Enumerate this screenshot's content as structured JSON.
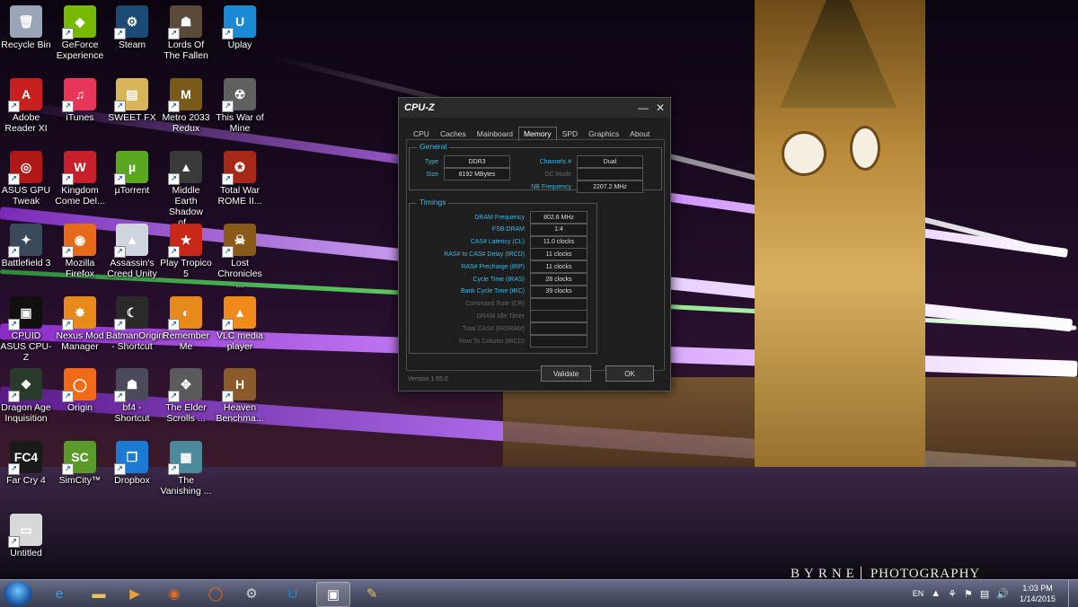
{
  "desktop": {
    "icons": [
      {
        "label": "Recycle Bin",
        "glyph": "🗑",
        "color": "#9aa6b8"
      },
      {
        "label": "GeForce Experience",
        "glyph": "◆",
        "color": "#76b900"
      },
      {
        "label": "Steam",
        "glyph": "⚙",
        "color": "#1b4b74"
      },
      {
        "label": "Lords Of The Fallen",
        "glyph": "☗",
        "color": "#5a4a3a"
      },
      {
        "label": "Uplay",
        "glyph": "U",
        "color": "#1a8ad4"
      },
      {
        "label": "Adobe Reader XI",
        "glyph": "A",
        "color": "#c8201e"
      },
      {
        "label": "iTunes",
        "glyph": "♫",
        "color": "#e8365a"
      },
      {
        "label": "SWEET FX",
        "glyph": "▤",
        "color": "#d8b45a"
      },
      {
        "label": "Metro 2033 Redux",
        "glyph": "M",
        "color": "#7a5a1a"
      },
      {
        "label": "This War of Mine",
        "glyph": "☢",
        "color": "#606060"
      },
      {
        "label": "ASUS GPU Tweak",
        "glyph": "◎",
        "color": "#b01818"
      },
      {
        "label": "Kingdom Come Del...",
        "glyph": "W",
        "color": "#c8202a"
      },
      {
        "label": "µTorrent",
        "glyph": "µ",
        "color": "#5aa820"
      },
      {
        "label": "Middle Earth Shadow of...",
        "glyph": "▲",
        "color": "#3a3a3a"
      },
      {
        "label": "Total War ROME II...",
        "glyph": "✪",
        "color": "#a82818"
      },
      {
        "label": "Battlefield 3",
        "glyph": "✦",
        "color": "#3a4a5a"
      },
      {
        "label": "Mozilla Firefox",
        "glyph": "◉",
        "color": "#e66a1a"
      },
      {
        "label": "Assassin's Creed Unity",
        "glyph": "▲",
        "color": "#cfd6de"
      },
      {
        "label": "Play Tropico 5",
        "glyph": "★",
        "color": "#c82818"
      },
      {
        "label": "Lost Chronicles ...",
        "glyph": "☠",
        "color": "#8a5a1a"
      },
      {
        "label": "CPUID ASUS CPU-Z",
        "glyph": "▣",
        "color": "#101010"
      },
      {
        "label": "Nexus Mod Manager",
        "glyph": "✸",
        "color": "#e88a1a"
      },
      {
        "label": "BatmanOrigins - Shortcut",
        "glyph": "☾",
        "color": "#2a2a2a"
      },
      {
        "label": "Remember Me",
        "glyph": "◐",
        "color": "#e88a1a"
      },
      {
        "label": "VLC media player",
        "glyph": "▲",
        "color": "#f08a1a"
      },
      {
        "label": "Dragon Age Inquisition",
        "glyph": "❖",
        "color": "#2a3a2a"
      },
      {
        "label": "Origin",
        "glyph": "◯",
        "color": "#f06a1a"
      },
      {
        "label": "bf4 - Shortcut",
        "glyph": "☗",
        "color": "#4a4a5a"
      },
      {
        "label": "The Elder Scrolls ...",
        "glyph": "✥",
        "color": "#5a5a5a"
      },
      {
        "label": "Heaven Benchma...",
        "glyph": "H",
        "color": "#8a5a2a"
      },
      {
        "label": "Far Cry 4",
        "glyph": "FC4",
        "color": "#1a1a1a"
      },
      {
        "label": "SimCity™",
        "glyph": "SC",
        "color": "#5a9a2a"
      },
      {
        "label": "Dropbox",
        "glyph": "❒",
        "color": "#1a7ad4"
      },
      {
        "label": "The Vanishing ...",
        "glyph": "▦",
        "color": "#4a8a9a"
      },
      {
        "label": "",
        "glyph": "",
        "color": "transparent"
      },
      {
        "label": "Untitled",
        "glyph": "▭",
        "color": "#d8d8d8"
      }
    ]
  },
  "cpuz": {
    "title": "CPU-Z",
    "tabs": [
      "CPU",
      "Caches",
      "Mainboard",
      "Memory",
      "SPD",
      "Graphics",
      "About"
    ],
    "active_tab": "Memory",
    "general": {
      "title": "General",
      "type_label": "Type",
      "type_value": "DDR3",
      "size_label": "Size",
      "size_value": "8192 MBytes",
      "channels_label": "Channels #",
      "channels_value": "Dual",
      "dc_mode_label": "DC Mode",
      "dc_mode_value": "",
      "nb_freq_label": "NB Frequency",
      "nb_freq_value": "2207.2 MHz"
    },
    "timings": {
      "title": "Timings",
      "rows": [
        {
          "label": "DRAM Frequency",
          "value": "802.6 MHz",
          "enabled": true
        },
        {
          "label": "FSB:DRAM",
          "value": "1:4",
          "enabled": true
        },
        {
          "label": "CAS# Latency (CL)",
          "value": "11.0 clocks",
          "enabled": true
        },
        {
          "label": "RAS# to CAS# Delay (tRCD)",
          "value": "11 clocks",
          "enabled": true
        },
        {
          "label": "RAS# Precharge (tRP)",
          "value": "11 clocks",
          "enabled": true
        },
        {
          "label": "Cycle Time (tRAS)",
          "value": "28 clocks",
          "enabled": true
        },
        {
          "label": "Bank Cycle Time (tRC)",
          "value": "39 clocks",
          "enabled": true
        },
        {
          "label": "Command Rate (CR)",
          "value": "",
          "enabled": false
        },
        {
          "label": "DRAM Idle Timer",
          "value": "",
          "enabled": false
        },
        {
          "label": "Total CAS# (tRDRAM)",
          "value": "",
          "enabled": false
        },
        {
          "label": "Row To Column (tRCD)",
          "value": "",
          "enabled": false
        }
      ]
    },
    "version": "Version 1.65.0",
    "validate_label": "Validate",
    "ok_label": "OK"
  },
  "wallpaper": {
    "watermark_left": "BYRNE",
    "watermark_right": "PHOTOGRAPHY"
  },
  "taskbar": {
    "pinned": [
      {
        "name": "internet-explorer-icon",
        "glyph": "e",
        "color": "#3aa0e8"
      },
      {
        "name": "file-explorer-icon",
        "glyph": "▬",
        "color": "#e8c45a"
      },
      {
        "name": "media-player-icon",
        "glyph": "▶",
        "color": "#e8a03a"
      },
      {
        "name": "firefox-icon",
        "glyph": "◉",
        "color": "#e66a1a"
      },
      {
        "name": "origin-icon",
        "glyph": "◯",
        "color": "#f06a1a"
      },
      {
        "name": "steam-icon",
        "glyph": "⚙",
        "color": "#cfd6de"
      },
      {
        "name": "uplay-icon",
        "glyph": "U",
        "color": "#1a8ad4"
      },
      {
        "name": "cpuz-icon",
        "glyph": "▣",
        "color": "#ffffff"
      },
      {
        "name": "paint-icon",
        "glyph": "✎",
        "color": "#e8c45a"
      }
    ],
    "language": "EN",
    "time": "1:03 PM",
    "date": "1/14/2015"
  }
}
